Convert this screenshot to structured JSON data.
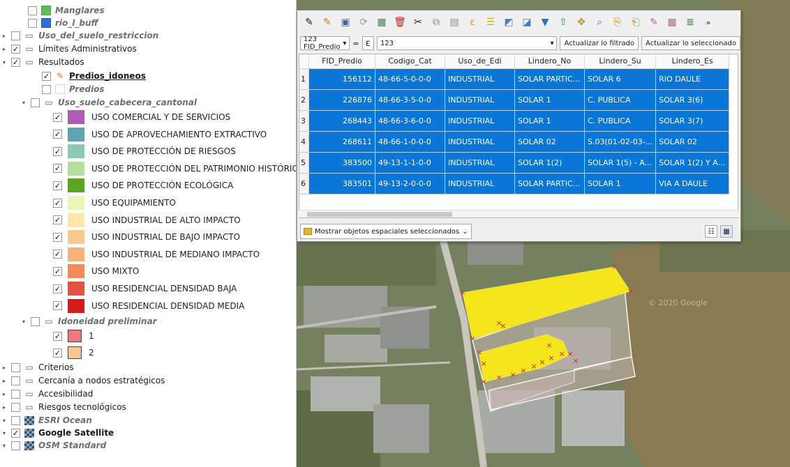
{
  "layers": [
    {
      "label": "Manglares",
      "style": "it",
      "checked": false,
      "arrow": "",
      "icon": "swatch",
      "color": "#5cbf56",
      "indent": 24
    },
    {
      "label": "rio_l_buff",
      "style": "it",
      "checked": false,
      "arrow": "",
      "icon": "swatch",
      "color": "#2d6fd6",
      "indent": 24
    },
    {
      "label": "Uso_del_suelo_restriccion",
      "style": "it",
      "checked": false,
      "arrow": "▸",
      "icon": "group",
      "indent": 0
    },
    {
      "label": "Límites Administrativos",
      "style": "",
      "checked": true,
      "arrow": "▸",
      "icon": "group",
      "indent": 0
    },
    {
      "label": "Resultados",
      "style": "",
      "checked": true,
      "arrow": "▾",
      "icon": "group",
      "indent": 0
    },
    {
      "label": "Predios_idoneos",
      "style": "ul",
      "checked": true,
      "arrow": "",
      "icon": "pencil",
      "indent": 44
    },
    {
      "label": "Predios",
      "style": "it",
      "checked": false,
      "arrow": "",
      "icon": "swatch",
      "color": "#ffffff",
      "indent": 44
    },
    {
      "label": "Uso_suelo_cabecera_cantonal",
      "style": "it",
      "checked": false,
      "arrow": "▾",
      "icon": "group",
      "indent": 28
    }
  ],
  "land_use": [
    {
      "label": "USO COMERCIAL Y DE SERVICIOS",
      "color": "#b05bb6"
    },
    {
      "label": "USO DE APROVECHAMIENTO EXTRACTIVO",
      "color": "#5fa3b3"
    },
    {
      "label": "USO DE PROTECCIÓN DE RIESGOS",
      "color": "#8cc9b3"
    },
    {
      "label": "USO DE PROTECCIÓN DEL PATRIMONIO HISTÓRICO Y",
      "color": "#b5df9e"
    },
    {
      "label": "USO DE PROTECCIÓN ECOLÓGICA",
      "color": "#5aa620"
    },
    {
      "label": "USO EQUIPAMIENTO",
      "color": "#edf5b6"
    },
    {
      "label": "USO INDUSTRIAL DE ALTO IMPACTO",
      "color": "#fce7a8"
    },
    {
      "label": "USO INDUSTRIAL DE BAJO IMPACTO",
      "color": "#fbc98e"
    },
    {
      "label": "USO INDUSTRIAL DE MEDIANO IMPACTO",
      "color": "#f9b27a"
    },
    {
      "label": "USO MIXTO",
      "color": "#f28c5a"
    },
    {
      "label": "USO RESIDENCIAL DENSIDAD BAJA",
      "color": "#e2503e"
    },
    {
      "label": "USO RESIDENCIAL DENSIDAD MEDIA",
      "color": "#d41b1b"
    }
  ],
  "idoneidad": {
    "group_label": "Idoneidad preliminar",
    "classes": [
      {
        "label": "1",
        "color": "#ee7a80"
      },
      {
        "label": "2",
        "color": "#f7c98f"
      }
    ]
  },
  "bottom_layers": [
    {
      "label": "Criterios",
      "style": "",
      "checked": false,
      "arrow": "▸",
      "icon": "group"
    },
    {
      "label": "Cercanía a nodos estratégicos",
      "style": "",
      "checked": false,
      "arrow": "▸",
      "icon": "group"
    },
    {
      "label": "Accesibilidad",
      "style": "",
      "checked": false,
      "arrow": "▸",
      "icon": "group"
    },
    {
      "label": "Riesgos tecnológicos",
      "style": "",
      "checked": false,
      "arrow": "▸",
      "icon": "group"
    },
    {
      "label": "ESRI Ocean",
      "style": "it",
      "checked": false,
      "arrow": "▾",
      "icon": "tiles"
    },
    {
      "label": "Google Satellite",
      "style": "b",
      "checked": true,
      "arrow": "▾",
      "icon": "tiles"
    },
    {
      "label": "OSM Standard",
      "style": "it",
      "checked": false,
      "arrow": "▾",
      "icon": "tiles"
    }
  ],
  "attribute_table": {
    "field_select": "123 FID_Predio",
    "operator": "=",
    "expression_icon": "ε",
    "filter_value": "123",
    "filter_button": "Actualizar lo filtrado",
    "update_selected_button": "Actualizar lo seleccionado",
    "show_selected_button": "Mostrar objetos espaciales seleccionados",
    "columns": [
      "FID_Predio",
      "Codigo_Cat",
      "Uso_de_Edi",
      "Lindero_No",
      "Lindero_Su",
      "Lindero_Es"
    ],
    "rows": [
      {
        "n": "1",
        "cells": [
          "156112",
          "48-66-5-0-0-0",
          "INDUSTRIAL",
          "SOLAR PARTIC...",
          "SOLAR 6",
          "RIO DAULE"
        ]
      },
      {
        "n": "2",
        "cells": [
          "226876",
          "48-66-3-5-0-0",
          "INDUSTRIAL",
          "SOLAR 1",
          "C. PUBLICA",
          "SOLAR 3(6)"
        ]
      },
      {
        "n": "3",
        "cells": [
          "268443",
          "48-66-3-6-0-0",
          "INDUSTRIAL",
          "SOLAR 1",
          "C. PUBLICA",
          "SOLAR 3(7)"
        ]
      },
      {
        "n": "4",
        "cells": [
          "268611",
          "48-66-1-0-0-0",
          "INDUSTRIAL",
          "SOLAR 02",
          "S.03(01-02-03-...",
          "SOLAR 02"
        ]
      },
      {
        "n": "5",
        "cells": [
          "383500",
          "49-13-1-1-0-0",
          "INDUSTRIAL",
          "SOLAR 1(2)",
          "SOLAR 1(5) - A...",
          "SOLAR 1(2) Y A..."
        ]
      },
      {
        "n": "6",
        "cells": [
          "383501",
          "49-13-2-0-0-0",
          "INDUSTRIAL",
          "SOLAR  PARTIC...",
          "SOLAR 1",
          "VIA  A DAULE"
        ]
      }
    ]
  },
  "map": {
    "watermark": "© 2020 Google",
    "selected_parcel_color": "#f4e61a",
    "vertex_marker_color": "#e0242a"
  }
}
